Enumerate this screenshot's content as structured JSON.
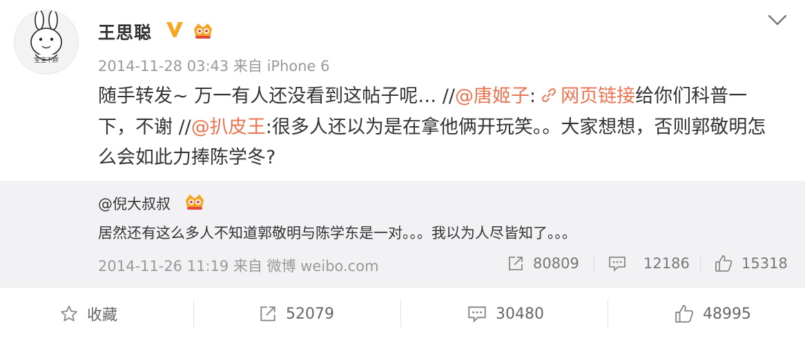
{
  "post": {
    "username": "王思聪",
    "meta": "2014-11-28 03:43 来自 iPhone 6",
    "avatar_caption": "宝宝不胖",
    "text": {
      "part1": "随手转发~ 万一有人还没看到这帖子呢… //",
      "mention1": "@唐姬子",
      "part2": ":",
      "link": "网页链接",
      "part3": "给你们科普一下，不谢 //",
      "mention2": "@扒皮王",
      "part4": ":很多人还以为是在拿他俩开玩笑。。大家想想，否则郭敬明怎么会如此力捧陈学冬?"
    },
    "link_color": "#eb7350",
    "vip_color": "#f5a623"
  },
  "original": {
    "user": "@倪大叔叔",
    "text": "居然还有这么多人不知道郭敬明与陈学东是一对。。。我以为人尽皆知了。。。",
    "meta": "2014-11-26 11:19 来自 微博 weibo.com",
    "reposts": "80809",
    "comments": "12186",
    "likes": "15318"
  },
  "actions": {
    "favorite": "收藏",
    "reposts": "52079",
    "comments": "30480",
    "likes": "48995"
  },
  "icons": [
    "avatar-bunny",
    "v-badge-icon",
    "crown-icon",
    "chevron-down-icon",
    "link-icon",
    "repost-icon",
    "comment-icon",
    "like-icon",
    "star-icon"
  ]
}
